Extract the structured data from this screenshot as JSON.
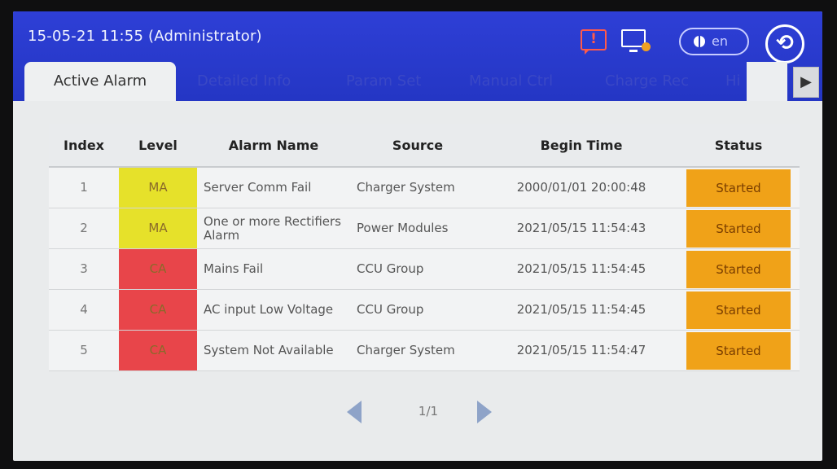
{
  "header": {
    "datetime": "15-05-21 11:55 (Administrator)",
    "alarm_icon_glyph": "!",
    "lang_label": "en",
    "back_glyph": "⟲"
  },
  "icons": {
    "alarm": "alarm-bell-icon",
    "monitor": "monitor-warning-icon",
    "globe": "globe-icon",
    "back": "back-arrow-icon"
  },
  "tabs": [
    {
      "label": "Active Alarm",
      "active": true
    },
    {
      "label": "Detailed Info"
    },
    {
      "label": "Param Set"
    },
    {
      "label": "Manual Ctrl"
    },
    {
      "label": "Charge Rec"
    },
    {
      "label": "Hi"
    }
  ],
  "tab_next_glyph": "▶",
  "table": {
    "columns": [
      "Index",
      "Level",
      "Alarm Name",
      "Source",
      "Begin Time",
      "Status"
    ],
    "rows": [
      {
        "index": "1",
        "level": "MA",
        "name": "Server Comm Fail",
        "source": "Charger System",
        "time": "2000/01/01 20:00:48",
        "status": "Started"
      },
      {
        "index": "2",
        "level": "MA",
        "name": "One or more Rectifiers Alarm",
        "source": "Power Modules",
        "time": "2021/05/15 11:54:43",
        "status": "Started"
      },
      {
        "index": "3",
        "level": "CA",
        "name": "Mains Fail",
        "source": "CCU Group",
        "time": "2021/05/15 11:54:45",
        "status": "Started"
      },
      {
        "index": "4",
        "level": "CA",
        "name": "AC input Low Voltage",
        "source": "CCU Group",
        "time": "2021/05/15 11:54:45",
        "status": "Started"
      },
      {
        "index": "5",
        "level": "CA",
        "name": "System Not Available",
        "source": "Charger System",
        "time": "2021/05/15 11:54:47",
        "status": "Started"
      }
    ]
  },
  "pager": {
    "text": "1/1"
  },
  "colors": {
    "header_blue": "#2436c4",
    "level_MA": "#e6e12a",
    "level_CA": "#e8454a",
    "status_started": "#f0a218"
  }
}
